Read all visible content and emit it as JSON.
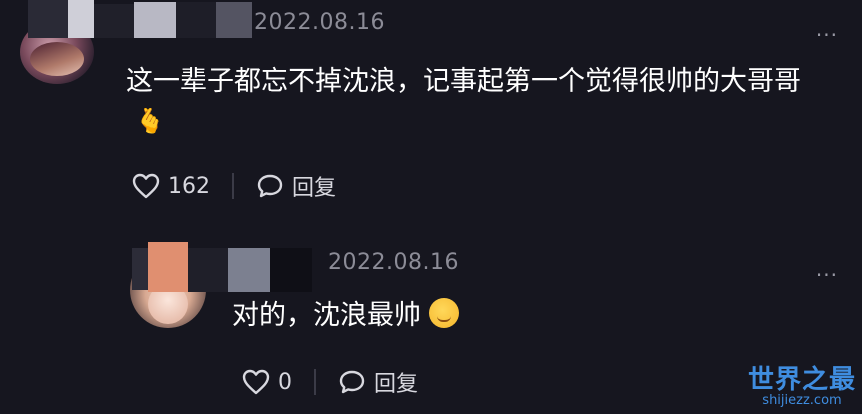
{
  "comments": [
    {
      "date": "2022.08.16",
      "more": "···",
      "text": "这一辈子都忘不掉沈浪，记事起第一个觉得很帅的大哥哥",
      "emoji": "🫰",
      "likes": "162",
      "reply_label": "回复"
    },
    {
      "date": "2022.08.16",
      "more": "···",
      "text": "对的，沈浪最帅",
      "likes": "0",
      "reply_label": "回复"
    }
  ],
  "watermark": {
    "title": "世界之最",
    "url": "shijiezz.com"
  },
  "colors": {
    "background": "#16161f",
    "date": "#8c8c97",
    "watermark": "#3f8de0"
  },
  "icons": [
    "heart-outline-icon",
    "comment-bubble-icon",
    "more-dots-icon"
  ]
}
